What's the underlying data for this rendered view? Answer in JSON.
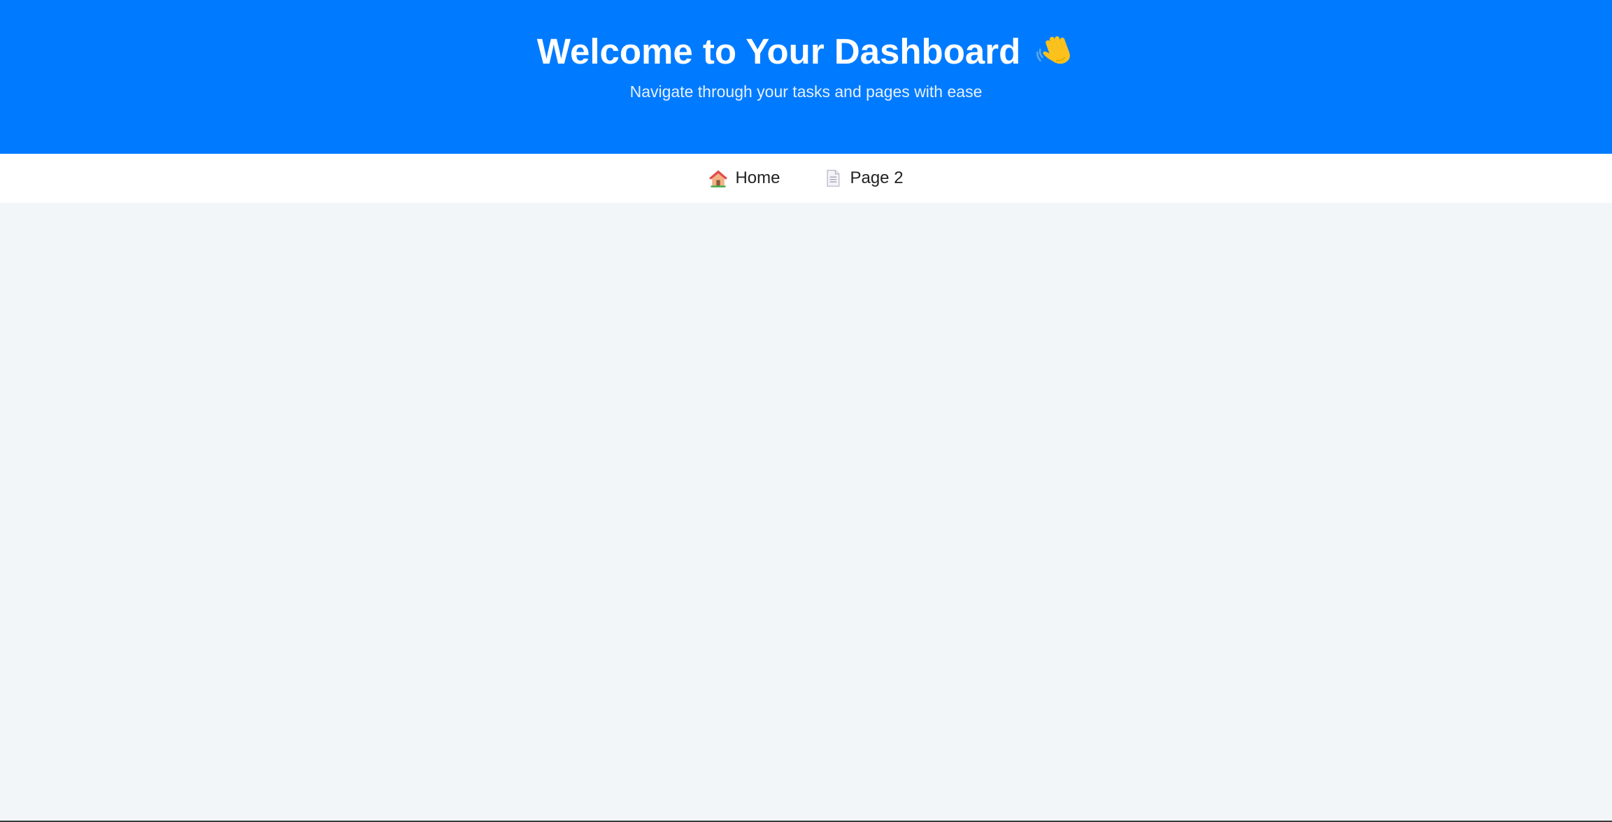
{
  "header": {
    "title": "Welcome to Your Dashboard",
    "title_icon": "waving-hand-icon",
    "subtitle": "Navigate through your tasks and pages with ease",
    "background_color": "#007bff"
  },
  "nav": {
    "items": [
      {
        "label": "Home",
        "icon": "house-icon"
      },
      {
        "label": "Page 2",
        "icon": "document-icon"
      }
    ]
  },
  "colors": {
    "page_background": "#f3f6f9",
    "nav_background": "#ffffff",
    "nav_text": "#222222"
  }
}
